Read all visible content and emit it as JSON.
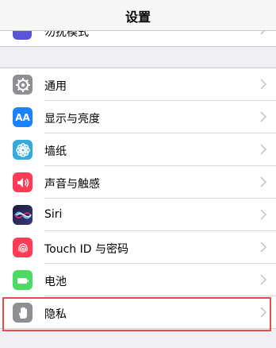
{
  "nav": {
    "title": "设置"
  },
  "peek": {
    "label": "勿扰模式"
  },
  "settings": [
    {
      "label": "通用",
      "icon": "gear-icon",
      "color": "#8e8e93"
    },
    {
      "label": "显示与亮度",
      "icon": "aa-icon",
      "icon_text": "AA",
      "color": "#1a82fb"
    },
    {
      "label": "墙纸",
      "icon": "flower-icon",
      "color": "#36aadc"
    },
    {
      "label": "声音与触感",
      "icon": "speaker-icon",
      "color": "#ff3b55"
    },
    {
      "label": "Siri",
      "icon": "siri-icon",
      "color": "#1b1b3a"
    },
    {
      "label": "Touch ID 与密码",
      "icon": "fingerprint-icon",
      "color": "#ff3b55"
    },
    {
      "label": "电池",
      "icon": "battery-icon",
      "color": "#4cd964"
    },
    {
      "label": "隐私",
      "icon": "hand-icon",
      "color": "#8e8e93"
    }
  ],
  "highlight_color": "#e94b4b"
}
